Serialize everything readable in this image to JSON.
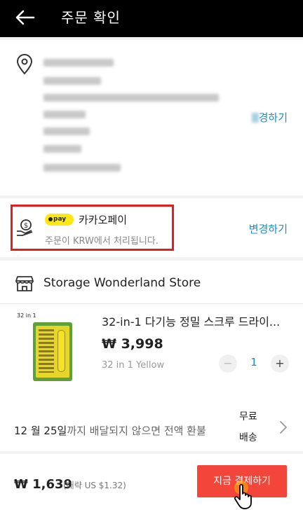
{
  "header": {
    "title": "주문 확인"
  },
  "address": {
    "change_label": "경하기"
  },
  "payment": {
    "badge": "pay",
    "method": "카카오페이",
    "note": "주문이 KRW에서 처리됩니다.",
    "change_label": "변경하기"
  },
  "store": {
    "name": "Storage Wonderland Store",
    "product": {
      "image_caption": "32 in 1",
      "title": "32-in-1 다기능 정밀 스크루 드라이...",
      "price": "₩ 3,998",
      "variant": "32 in 1 Yellow",
      "quantity": "1",
      "minus": "−",
      "plus": "+"
    },
    "delivery": {
      "date": "12 월 25일",
      "message": "까지 배달되지 않으면 전액 환불",
      "shipping": "무료 배송"
    }
  },
  "footer": {
    "total": "₩ 1,639",
    "approx": "(대략 US $1.32)",
    "pay_button": "지금 결제하기"
  },
  "colors": {
    "accent": "#1a8cc7",
    "pay_button": "#f2463b",
    "kakao": "#ffe812",
    "highlight_box": "#e02020"
  }
}
